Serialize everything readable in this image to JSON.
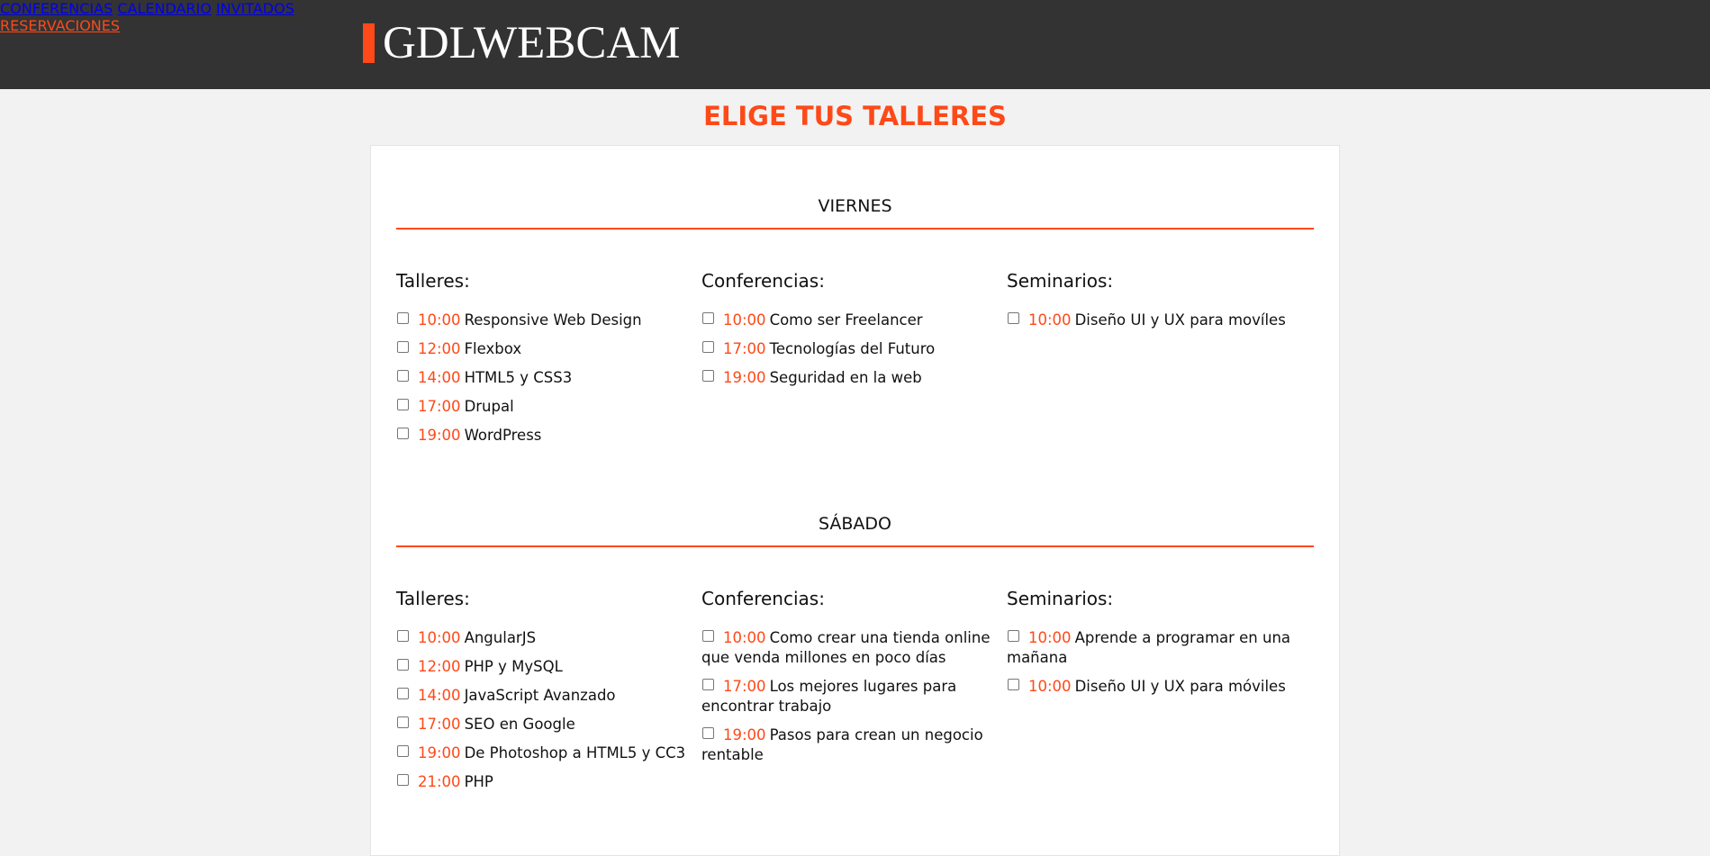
{
  "brand": {
    "name": "GDLWEBCAM",
    "accent": "#fe4918"
  },
  "nav": {
    "conferencias": "CONFERENCIAS",
    "calendario": "CALENDARIO",
    "invitados": "INVITADOS",
    "reservaciones": "RESERVACIONES"
  },
  "page_title": "ELIGE TUS TALLERES",
  "days": [
    {
      "title": "VIERNES",
      "columns": [
        {
          "heading": "Talleres:",
          "items": [
            {
              "time": "10:00",
              "label": "Responsive Web Design"
            },
            {
              "time": "12:00",
              "label": "Flexbox"
            },
            {
              "time": "14:00",
              "label": "HTML5 y CSS3"
            },
            {
              "time": "17:00",
              "label": "Drupal"
            },
            {
              "time": "19:00",
              "label": "WordPress"
            }
          ]
        },
        {
          "heading": "Conferencias:",
          "items": [
            {
              "time": "10:00",
              "label": "Como ser Freelancer"
            },
            {
              "time": "17:00",
              "label": "Tecnologías del Futuro"
            },
            {
              "time": "19:00",
              "label": "Seguridad en la web"
            }
          ]
        },
        {
          "heading": "Seminarios:",
          "items": [
            {
              "time": "10:00",
              "label": "Diseño UI y UX para movíles"
            }
          ]
        }
      ]
    },
    {
      "title": "SÁBADO",
      "columns": [
        {
          "heading": "Talleres:",
          "items": [
            {
              "time": "10:00",
              "label": "AngularJS"
            },
            {
              "time": "12:00",
              "label": "PHP y MySQL"
            },
            {
              "time": "14:00",
              "label": "JavaScript Avanzado"
            },
            {
              "time": "17:00",
              "label": "SEO en Google"
            },
            {
              "time": "19:00",
              "label": "De Photoshop a HTML5 y CC3"
            },
            {
              "time": "21:00",
              "label": "PHP"
            }
          ]
        },
        {
          "heading": "Conferencias:",
          "items": [
            {
              "time": "10:00",
              "label": "Como crear una tienda online que venda millones en poco días"
            },
            {
              "time": "17:00",
              "label": "Los mejores lugares para encontrar trabajo"
            },
            {
              "time": "19:00",
              "label": "Pasos para crean un negocio rentable"
            }
          ]
        },
        {
          "heading": "Seminarios:",
          "items": [
            {
              "time": "10:00",
              "label": "Aprende a programar en una mañana"
            },
            {
              "time": "10:00",
              "label": "Diseño UI y UX para móviles"
            }
          ]
        }
      ]
    }
  ]
}
